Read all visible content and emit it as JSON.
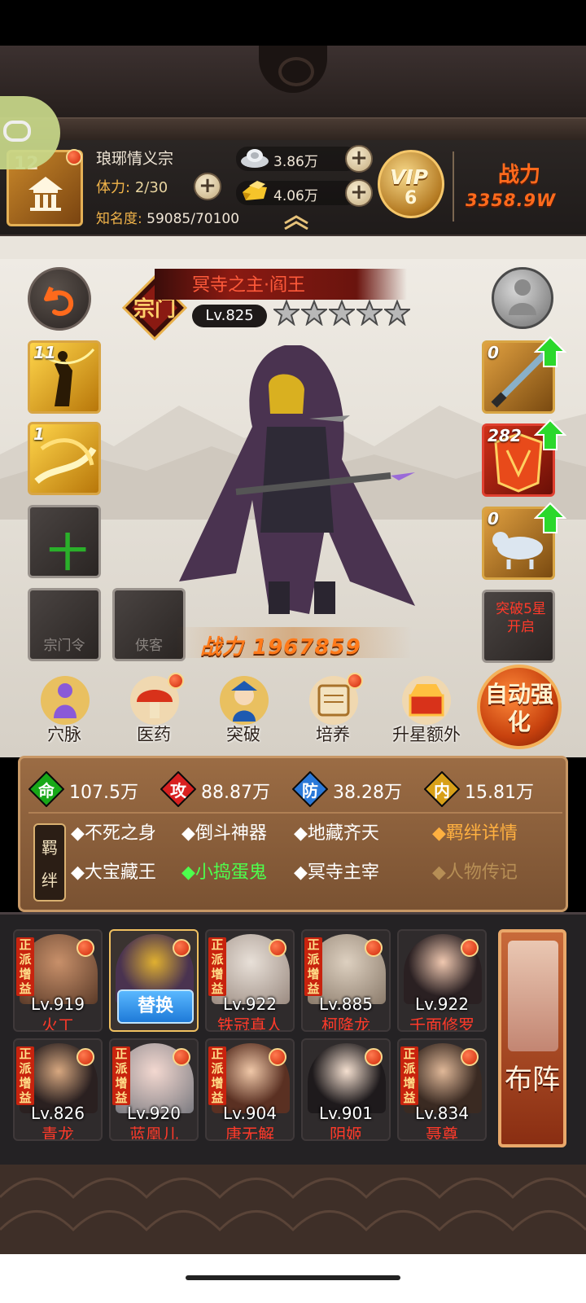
{
  "player": {
    "level": "12",
    "name": "琅琊情义宗",
    "stamina_label": "体力:",
    "stamina_value": "2/30",
    "fame_label": "知名度:",
    "fame_value": "59085/70100"
  },
  "currency": {
    "silver": "3.86万",
    "gold": "4.06万"
  },
  "vip": {
    "label": "VIP",
    "level": "6"
  },
  "power": {
    "title": "战力",
    "value": "3358.9W"
  },
  "hero": {
    "name": "冥寺之主·阎王",
    "sect_badge": "宗门",
    "level": "Lv.825",
    "stars": 5,
    "combat_power_label": "战力",
    "combat_power": "1967859"
  },
  "skills_left": [
    {
      "count": "11",
      "name": "skill-slot-1"
    },
    {
      "count": "1",
      "name": "skill-slot-2"
    }
  ],
  "empty_slots": {
    "sect_token": "宗门令",
    "companion": "侠客"
  },
  "equipment_right": [
    {
      "count": "0"
    },
    {
      "count": "282"
    },
    {
      "count": "0"
    }
  ],
  "breakthrough_lock": "突破5星开启",
  "actions": [
    {
      "label": "穴脉"
    },
    {
      "label": "医药"
    },
    {
      "label": "突破"
    },
    {
      "label": "培养"
    },
    {
      "label": "升星额外"
    }
  ],
  "auto_enhance": "自动强化",
  "stats": [
    {
      "char": "命",
      "value": "107.5万",
      "color": "#18a818"
    },
    {
      "char": "攻",
      "value": "88.87万",
      "color": "#d82020"
    },
    {
      "char": "防",
      "value": "38.28万",
      "color": "#2a78d8"
    },
    {
      "char": "内",
      "value": "15.81万",
      "color": "#d8a018"
    }
  ],
  "bonds": {
    "badge": "羁绊",
    "items": [
      "◆不死之身",
      "◆倒斗神器",
      "◆地藏齐天",
      "◆大宝藏王",
      "◆小捣蛋鬼",
      "◆冥寺主宰"
    ],
    "detail_link": "◆羁绊详情",
    "bio_link": "◆人物传记"
  },
  "lineup": {
    "tag": "正派增益",
    "replace_label": "替换",
    "formation_label": "布阵",
    "heroes": [
      {
        "level": "Lv.919",
        "name": "火工"
      },
      {
        "level": "",
        "name": ""
      },
      {
        "level": "Lv.922",
        "name": "铁冠真人"
      },
      {
        "level": "Lv.885",
        "name": "柯降龙"
      },
      {
        "level": "Lv.922",
        "name": "千面修罗"
      },
      {
        "level": "Lv.826",
        "name": "青龙"
      },
      {
        "level": "Lv.920",
        "name": "蓝凰儿"
      },
      {
        "level": "Lv.904",
        "name": "唐无解"
      },
      {
        "level": "Lv.901",
        "name": "阴姬"
      },
      {
        "level": "Lv.834",
        "name": "聂尊"
      }
    ]
  }
}
